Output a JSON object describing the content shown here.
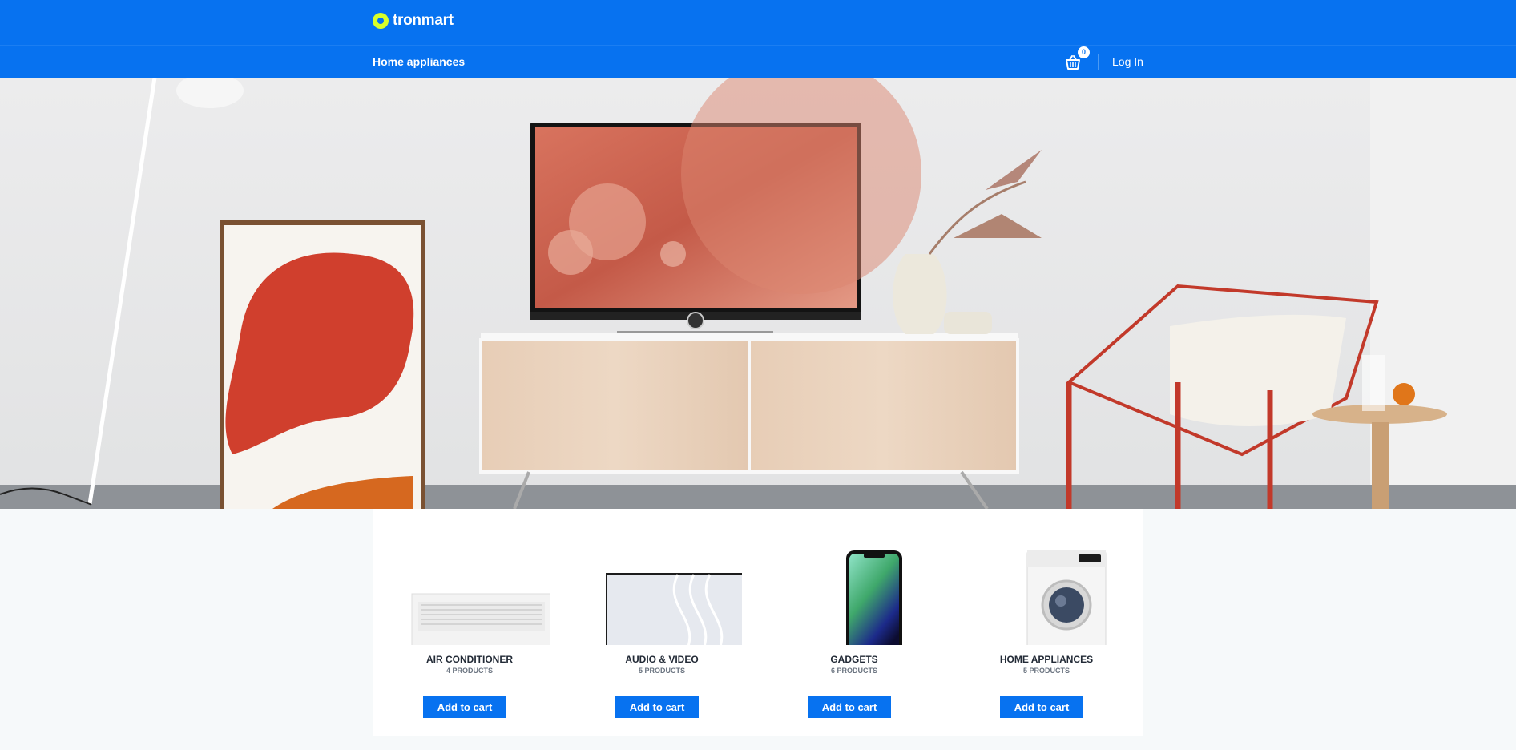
{
  "brand": {
    "name": "tronmart",
    "accent": "#0772f0",
    "logo_color": "#d8ff2a"
  },
  "nav": {
    "home_appliances": "Home appliances",
    "cart_count": "0",
    "login": "Log In"
  },
  "products": [
    {
      "title": "AIR CONDITIONER",
      "count": "4 PRODUCTS",
      "button": "Add to cart"
    },
    {
      "title": "AUDIO & VIDEO",
      "count": "5 PRODUCTS",
      "button": "Add to cart"
    },
    {
      "title": "GADGETS",
      "count": "6 PRODUCTS",
      "button": "Add to cart"
    },
    {
      "title": "HOME APPLIANCES",
      "count": "5 PRODUCTS",
      "button": "Add to cart"
    }
  ]
}
